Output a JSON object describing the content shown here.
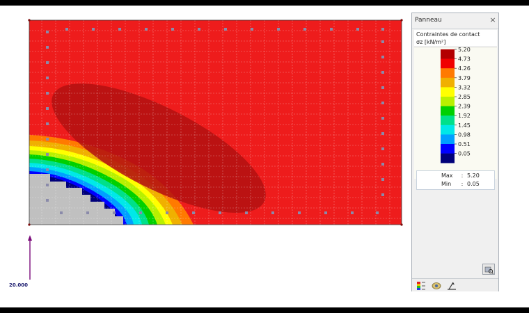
{
  "panel": {
    "title": "Panneau",
    "close_glyph": "×",
    "legend_title": "Contraintes de contact",
    "legend_unit": "σz [kN/m²]",
    "legend_values": [
      "5.20",
      "4.73",
      "4.26",
      "3.79",
      "3.32",
      "2.85",
      "2.39",
      "1.92",
      "1.45",
      "0.98",
      "0.51",
      "0.05"
    ],
    "legend_colors": [
      "#b30000",
      "#f00000",
      "#ff7a00",
      "#f0b000",
      "#ffff00",
      "#b8f000",
      "#00d000",
      "#00e08a",
      "#00e8e8",
      "#00a0ff",
      "#0000ff",
      "#00007a"
    ],
    "max_label": "Max",
    "max_value": "5.20",
    "min_label": "Min",
    "min_value": "0.05",
    "separator": ":",
    "toolbar": {
      "tool_icon": "settings-icon",
      "tabs": [
        "color-scale-icon",
        "view-icon",
        "diagram-icon"
      ]
    }
  },
  "viewport": {
    "axis_label": "20.000",
    "colors": {
      "field": "#ee1c1c",
      "dark_zone": "#b21010",
      "support": "#c0c0c0",
      "axis": "#7a0a7a"
    }
  }
}
